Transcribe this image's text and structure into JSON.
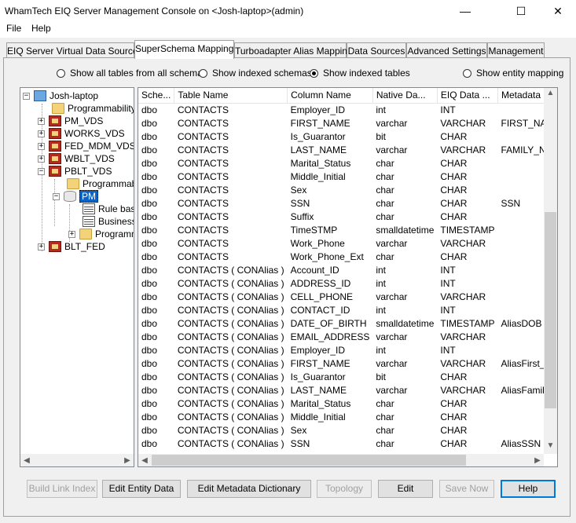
{
  "window": {
    "title": "WhamTech EIQ Server Management Console on <Josh-laptop>(admin)",
    "minimize": "—",
    "maximize": "☐",
    "close": "✕"
  },
  "menu": {
    "file": "File",
    "help": "Help"
  },
  "tabs": [
    "EIQ Server Virtual Data Sources",
    "SuperSchema Mapping",
    "Turboadapter Alias Mapping",
    "Data Sources",
    "Advanced Settings",
    "Management"
  ],
  "active_tab": "SuperSchema Mapping",
  "view_options": [
    {
      "label": "Show all tables from all schemas",
      "selected": false
    },
    {
      "label": "Show indexed schemas",
      "selected": false
    },
    {
      "label": "Show indexed tables",
      "selected": true
    },
    {
      "label": "Show entity mapping",
      "selected": false
    }
  ],
  "tree": [
    {
      "label": "Josh-laptop",
      "icon": "computer-icon"
    },
    {
      "label": "Programmability",
      "icon": "folder-icon"
    },
    {
      "label": "PM_VDS",
      "icon": "vds-icon"
    },
    {
      "label": "WORKS_VDS",
      "icon": "vds-icon"
    },
    {
      "label": "FED_MDM_VDS",
      "icon": "vds-icon"
    },
    {
      "label": "WBLT_VDS",
      "icon": "vds-icon"
    },
    {
      "label": "PBLT_VDS",
      "icon": "vds-icon"
    },
    {
      "label": "Programmability",
      "icon": "folder-icon"
    },
    {
      "label": "PM",
      "icon": "database-icon"
    },
    {
      "label": "Rule base",
      "icon": "grid-icon"
    },
    {
      "label": "Business",
      "icon": "grid-icon"
    },
    {
      "label": "Programmability",
      "icon": "folder-icon"
    },
    {
      "label": "BLT_FED",
      "icon": "vds-icon"
    }
  ],
  "grid": {
    "columns": [
      "Sche...",
      "Table Name",
      "Column Name",
      "Native Da...",
      "EIQ Data ...",
      "Metadata Column"
    ],
    "rows": [
      [
        "dbo",
        "CONTACTS",
        "Employer_ID",
        "int",
        "INT",
        ""
      ],
      [
        "dbo",
        "CONTACTS",
        "FIRST_NAME",
        "varchar",
        "VARCHAR",
        "FIRST_NAME"
      ],
      [
        "dbo",
        "CONTACTS",
        "Is_Guarantor",
        "bit",
        "CHAR",
        ""
      ],
      [
        "dbo",
        "CONTACTS",
        "LAST_NAME",
        "varchar",
        "VARCHAR",
        "FAMILY_NAME"
      ],
      [
        "dbo",
        "CONTACTS",
        "Marital_Status",
        "char",
        "CHAR",
        ""
      ],
      [
        "dbo",
        "CONTACTS",
        "Middle_Initial",
        "char",
        "CHAR",
        ""
      ],
      [
        "dbo",
        "CONTACTS",
        "Sex",
        "char",
        "CHAR",
        ""
      ],
      [
        "dbo",
        "CONTACTS",
        "SSN",
        "char",
        "CHAR",
        "SSN"
      ],
      [
        "dbo",
        "CONTACTS",
        "Suffix",
        "char",
        "CHAR",
        ""
      ],
      [
        "dbo",
        "CONTACTS",
        "TimeSTMP",
        "smalldatetime",
        "TIMESTAMP",
        ""
      ],
      [
        "dbo",
        "CONTACTS",
        "Work_Phone",
        "varchar",
        "VARCHAR",
        ""
      ],
      [
        "dbo",
        "CONTACTS",
        "Work_Phone_Ext",
        "char",
        "CHAR",
        ""
      ],
      [
        "dbo",
        "CONTACTS ( CONAlias )",
        "Account_ID",
        "int",
        "INT",
        ""
      ],
      [
        "dbo",
        "CONTACTS ( CONAlias )",
        "ADDRESS_ID",
        "int",
        "INT",
        ""
      ],
      [
        "dbo",
        "CONTACTS ( CONAlias )",
        "CELL_PHONE",
        "varchar",
        "VARCHAR",
        ""
      ],
      [
        "dbo",
        "CONTACTS ( CONAlias )",
        "CONTACT_ID",
        "int",
        "INT",
        ""
      ],
      [
        "dbo",
        "CONTACTS ( CONAlias )",
        "DATE_OF_BIRTH",
        "smalldatetime",
        "TIMESTAMP",
        "AliasDOB"
      ],
      [
        "dbo",
        "CONTACTS ( CONAlias )",
        "EMAIL_ADDRESS",
        "varchar",
        "VARCHAR",
        ""
      ],
      [
        "dbo",
        "CONTACTS ( CONAlias )",
        "Employer_ID",
        "int",
        "INT",
        ""
      ],
      [
        "dbo",
        "CONTACTS ( CONAlias )",
        "FIRST_NAME",
        "varchar",
        "VARCHAR",
        "AliasFirst_Name"
      ],
      [
        "dbo",
        "CONTACTS ( CONAlias )",
        "Is_Guarantor",
        "bit",
        "CHAR",
        ""
      ],
      [
        "dbo",
        "CONTACTS ( CONAlias )",
        "LAST_NAME",
        "varchar",
        "VARCHAR",
        "AliasFamily_Name"
      ],
      [
        "dbo",
        "CONTACTS ( CONAlias )",
        "Marital_Status",
        "char",
        "CHAR",
        ""
      ],
      [
        "dbo",
        "CONTACTS ( CONAlias )",
        "Middle_Initial",
        "char",
        "CHAR",
        ""
      ],
      [
        "dbo",
        "CONTACTS ( CONAlias )",
        "Sex",
        "char",
        "CHAR",
        ""
      ],
      [
        "dbo",
        "CONTACTS ( CONAlias )",
        "SSN",
        "char",
        "CHAR",
        "AliasSSN"
      ]
    ]
  },
  "buttons": [
    {
      "label": "Build Link Index",
      "enabled": false
    },
    {
      "label": "Edit Entity Data",
      "enabled": true
    },
    {
      "label": "Edit Metadata Dictionary",
      "enabled": true
    },
    {
      "label": "Topology",
      "enabled": false
    },
    {
      "label": "Edit",
      "enabled": true
    },
    {
      "label": "Save Now",
      "enabled": false
    },
    {
      "label": "Help",
      "enabled": true
    }
  ],
  "colors": {
    "selection": "#0a64c8",
    "default_button_border": "#0078d7"
  }
}
